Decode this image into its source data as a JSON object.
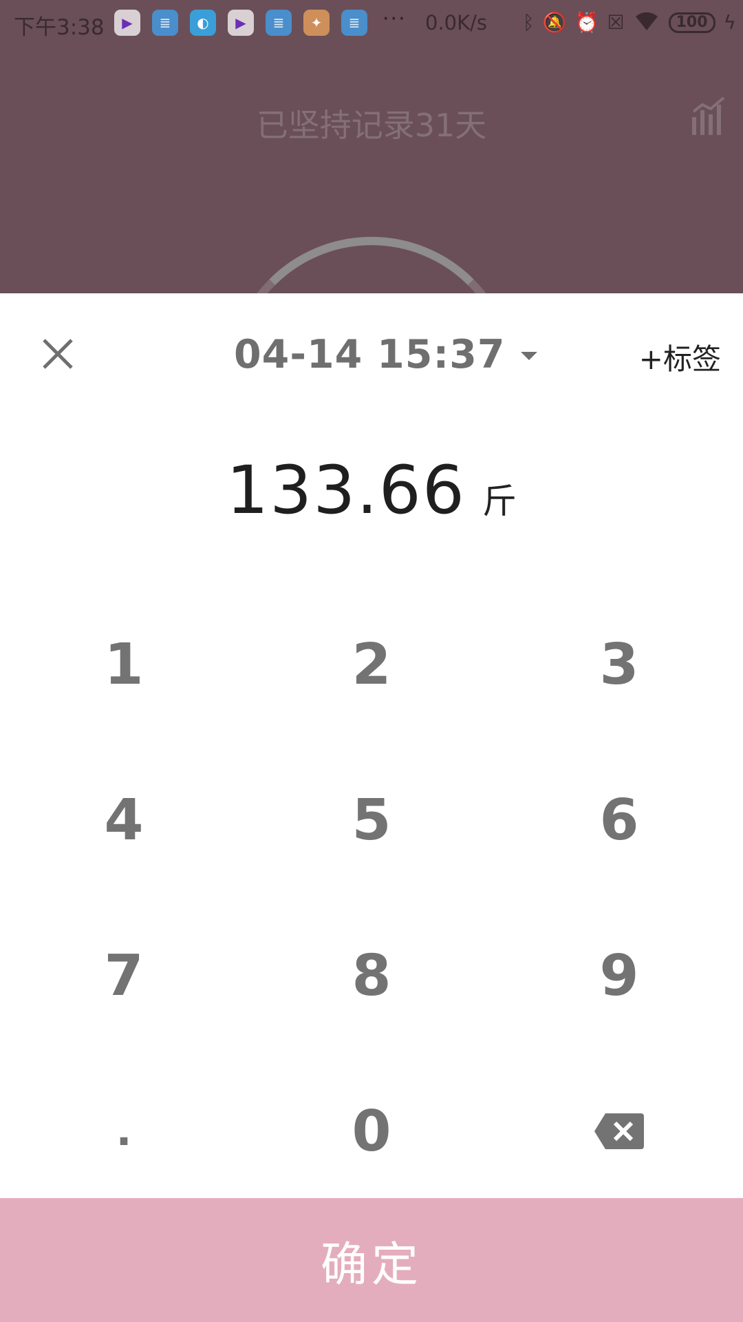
{
  "status_bar": {
    "time": "下午3:38",
    "speed": "0.0K/s",
    "battery": "100",
    "more": "···"
  },
  "background": {
    "title": "已坚持记录31天"
  },
  "sheet": {
    "datetime": "04-14 15:37",
    "tag_label": "+标签",
    "value": "133.66",
    "unit": "斤"
  },
  "keypad": {
    "k1": "1",
    "k2": "2",
    "k3": "3",
    "k4": "4",
    "k5": "5",
    "k6": "6",
    "k7": "7",
    "k8": "8",
    "k9": "9",
    "kdot": ".",
    "k0": "0"
  },
  "confirm_label": "确定",
  "colors": {
    "overlay_bg": "#6a4f58",
    "confirm_bg": "#e4adbd",
    "key_text": "#737373"
  }
}
